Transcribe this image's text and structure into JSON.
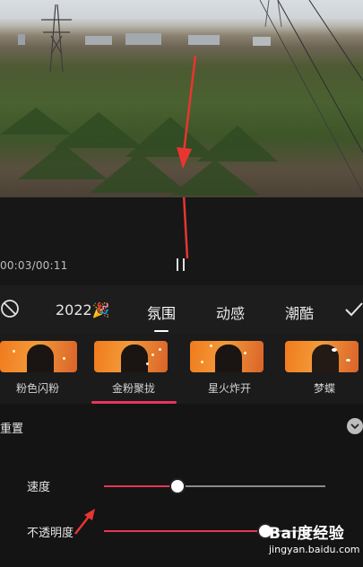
{
  "player": {
    "time": "00:03/00:11"
  },
  "tabs": [
    {
      "label": "2022🎉",
      "active": false
    },
    {
      "label": "氛围",
      "active": true
    },
    {
      "label": "动感",
      "active": false
    },
    {
      "label": "潮酷",
      "active": false
    }
  ],
  "effects": [
    {
      "label": "粉色闪粉",
      "selected": false
    },
    {
      "label": "金粉聚拢",
      "selected": true
    },
    {
      "label": "星火炸开",
      "selected": false
    },
    {
      "label": "梦蝶",
      "selected": false
    }
  ],
  "reset_label": "重置",
  "sliders": [
    {
      "label": "速度",
      "value_fraction": 0.33
    },
    {
      "label": "不透明度",
      "value_fraction": 0.73
    }
  ],
  "colors": {
    "accent": "#e8355a",
    "annotation_arrow": "#e8352f"
  },
  "watermark": {
    "text": "Bai度经验",
    "url": "jingyan.baidu.com"
  }
}
